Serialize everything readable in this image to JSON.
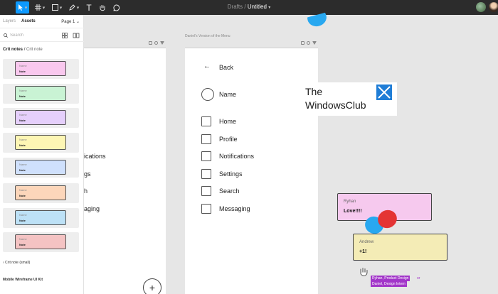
{
  "toolbar": {
    "breadcrumb_project": "Drafts",
    "breadcrumb_sep": "/",
    "file_name": "Untitled",
    "caret": "▾",
    "text_tool": "T"
  },
  "panel": {
    "tabs": {
      "layers": "Layers",
      "assets": "Assets"
    },
    "page_select": "Page 1 ⌄",
    "search_placeholder": "Search",
    "breadcrumb_root": "Crit notes",
    "breadcrumb_sep": "/",
    "breadcrumb_current": "Crit note",
    "asset_cards": [
      {
        "name": "Name",
        "note": "Note",
        "color": "#f9c8ee"
      },
      {
        "name": "Name",
        "note": "Note",
        "color": "#c9f3d4"
      },
      {
        "name": "Name",
        "note": "Note",
        "color": "#e5cffb"
      },
      {
        "name": "Name",
        "note": "Note",
        "color": "#fdf6b4"
      },
      {
        "name": "Name",
        "note": "Note",
        "color": "#cfe0fc"
      },
      {
        "name": "Name",
        "note": "Note",
        "color": "#fcd6ba"
      },
      {
        "name": "Name",
        "note": "Note",
        "color": "#bde1f6"
      },
      {
        "name": "Name",
        "note": "Note",
        "color": "#f4c3c3"
      }
    ],
    "section_small": "› Crit note (small)",
    "section_kit": "Mobile Wireframe UI Kit"
  },
  "left_frame": {
    "items": [
      "ications",
      "gs",
      "h",
      "aging"
    ],
    "plus_label": "+"
  },
  "right_frame": {
    "label": "Daniel's Version of the Menu",
    "back_arrow": "←",
    "back_label": "Back",
    "name_label": "Name",
    "items": [
      "Home",
      "Profile",
      "Notifications",
      "Settings",
      "Search",
      "Messaging"
    ]
  },
  "watermark": {
    "line1": "The",
    "line2": "WindowsClub"
  },
  "stickies": [
    {
      "author": "Ryhan",
      "message": "Love!!!!",
      "color": "#f6c9ee"
    },
    {
      "author": "Andrew",
      "message": "+1!",
      "color": "#f4ecb6"
    }
  ],
  "cursor_tags": {
    "ryhan": "Ryhan, Product Design",
    "or": "or",
    "daniel": "Daniel, Design Intern"
  },
  "colors": {
    "toolbar_bg": "#2c2c2c",
    "accent": "#0d99ff",
    "canvas": "#e6e6e6",
    "blob_blue": "#28a8f0",
    "blob_red": "#e43434",
    "tag_purple": "#a236c9"
  }
}
